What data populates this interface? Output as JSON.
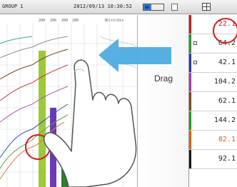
{
  "header": {
    "group": "GROUP 1",
    "datetime": "2012/09/13 10:30:52"
  },
  "scale_labels": [
    "200",
    "200",
    "200",
    "200",
    "3D(st/div"
  ],
  "hint": {
    "drag_label": "Drag"
  },
  "channels": [
    {
      "value": "22.1",
      "color": "#d21a1a",
      "highlighted": true
    },
    {
      "value": "64.2",
      "color": "#2a9a2a"
    },
    {
      "value": "42.1",
      "color": "#2a3ab8"
    },
    {
      "value": "104.2",
      "color": "#b03ab0"
    },
    {
      "value": "62.1",
      "color": "#7a4a20"
    },
    {
      "value": "144.2",
      "color": "#2a9a2a"
    },
    {
      "value": "82.1",
      "color": "#e06010"
    },
    {
      "value": "92.1",
      "color": "#1a1a1a"
    }
  ],
  "colors": {
    "highlight_ring": "#d11a1a",
    "arrow": "#4aa8e0",
    "bar_green": "#9dc93a",
    "bar_purple": "#6a3ab0",
    "bar_dark_green": "#2e7d32"
  },
  "icons": [
    "memory-icon",
    "menu-icon",
    "grid-view-icon",
    "hand-pointer-icon",
    "swipe-arrow-icon"
  ]
}
